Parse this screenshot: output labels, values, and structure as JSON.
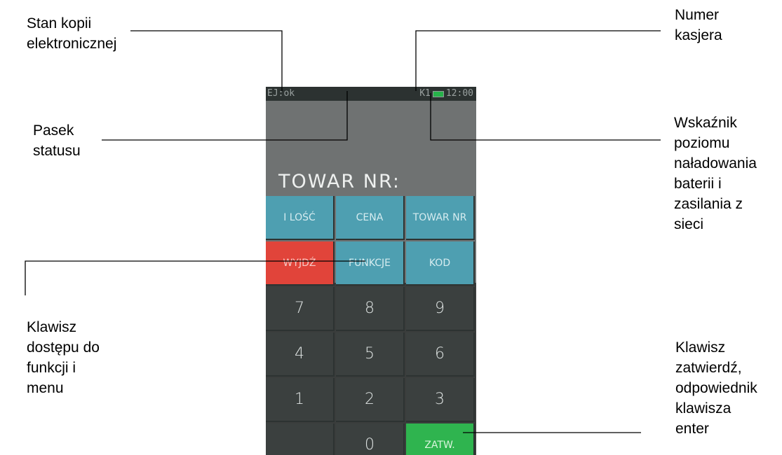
{
  "callouts": {
    "ej_state": [
      "Stan kopii",
      "elektronicznej"
    ],
    "cashier": [
      "Numer",
      "kasjera"
    ],
    "status_bar": [
      "Pasek",
      "statusu"
    ],
    "battery": [
      "Wskaźnik",
      "poziomu",
      "naładowania",
      "baterii i",
      "zasilania z",
      "sieci"
    ],
    "function_key": [
      "Klawisz",
      "dostępu do",
      "funkcji i",
      "menu"
    ],
    "confirm_key": [
      "Klawisz",
      "zatwierdź,",
      "odpowiednik",
      "klawisza",
      "enter"
    ]
  },
  "device": {
    "status_bar": {
      "ej": "EJ:ok",
      "cashier": "K1",
      "time": "12:00"
    },
    "display_prompt": "TOWAR NR:",
    "keypad": {
      "row1": [
        "I LOŚĆ",
        "CENA",
        "TOWAR NR"
      ],
      "row2": [
        "WYJDŹ",
        "FUNKCJE",
        "KOD"
      ],
      "row3": [
        "7",
        "8",
        "9"
      ],
      "row4": [
        "4",
        "5",
        "6"
      ],
      "row5": [
        "1",
        "2",
        "3"
      ],
      "row6": [
        ",",
        "0",
        "ZATW."
      ]
    }
  },
  "colors": {
    "function_keys": "#4e9fb1",
    "exit_key": "#e1443a",
    "confirm_key": "#2fb44f",
    "number_keys": "#3b403f",
    "display": "#6f7272"
  }
}
